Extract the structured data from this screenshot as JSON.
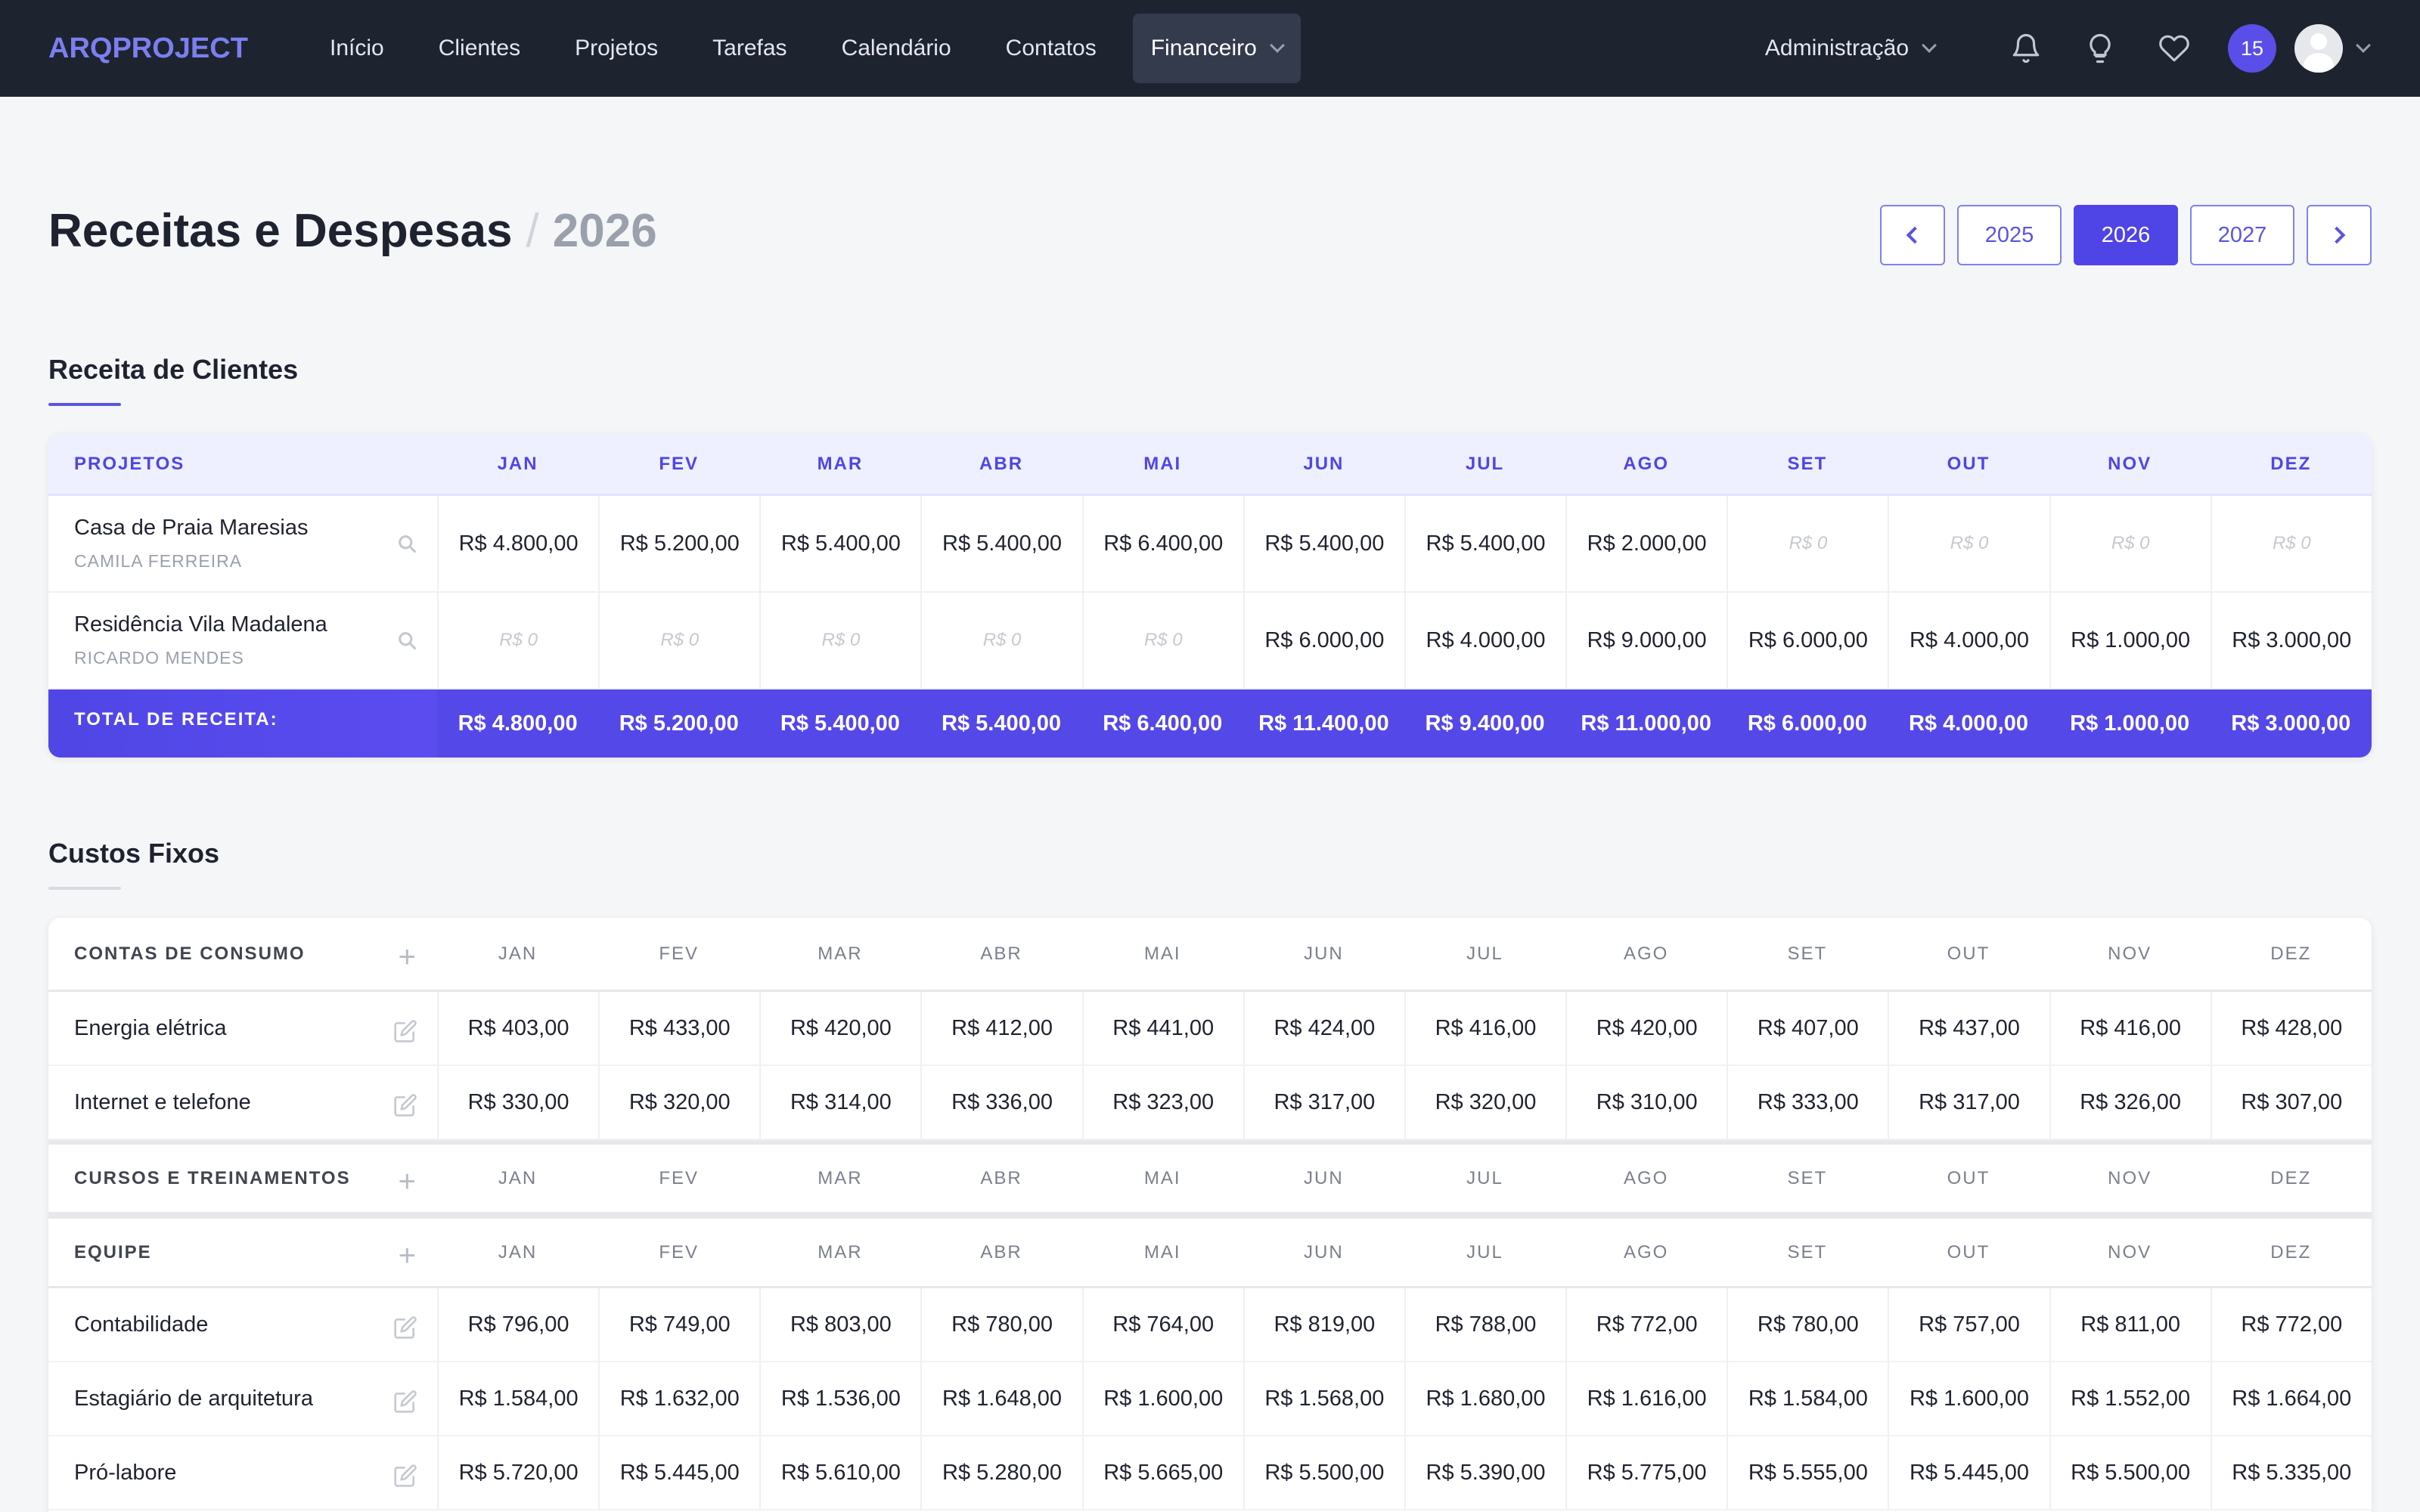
{
  "brand": {
    "logo_text": "ARQPROJECT",
    "accent": "#4f46e5",
    "nav_bg": "#1e2330"
  },
  "nav": {
    "items": [
      {
        "label": "Início"
      },
      {
        "label": "Clientes"
      },
      {
        "label": "Projetos"
      },
      {
        "label": "Tarefas"
      },
      {
        "label": "Calendário"
      },
      {
        "label": "Contatos"
      },
      {
        "label": "Financeiro",
        "active": true
      }
    ],
    "admin_label": "Administração",
    "icons": [
      "bell-icon",
      "lightbulb-icon",
      "heart-icon"
    ],
    "badge_count": "15",
    "avatar": "avatar"
  },
  "page": {
    "title": "Receitas e Despesas",
    "separator": "/",
    "year": "2026",
    "year_options": [
      "2025",
      "2026",
      "2027"
    ],
    "active_year": "2026"
  },
  "months": [
    "JAN",
    "FEV",
    "MAR",
    "ABR",
    "MAI",
    "JUN",
    "JUL",
    "AGO",
    "SET",
    "OUT",
    "NOV",
    "DEZ"
  ],
  "revenue": {
    "section_title": "Receita de Clientes",
    "header_label": "PROJETOS",
    "projects": [
      {
        "name": "Casa de Praia Maresias",
        "client": "CAMILA FERREIRA",
        "values": [
          "R$ 4.800,00",
          "R$ 5.200,00",
          "R$ 5.400,00",
          "R$ 5.400,00",
          "R$ 6.400,00",
          "R$ 5.400,00",
          "R$ 5.400,00",
          "R$ 2.000,00",
          "R$ 0",
          "R$ 0",
          "R$ 0",
          "R$ 0"
        ]
      },
      {
        "name": "Residência Vila Madalena",
        "client": "RICARDO MENDES",
        "values": [
          "R$ 0",
          "R$ 0",
          "R$ 0",
          "R$ 0",
          "R$ 0",
          "R$ 6.000,00",
          "R$ 4.000,00",
          "R$ 9.000,00",
          "R$ 6.000,00",
          "R$ 4.000,00",
          "R$ 1.000,00",
          "R$ 3.000,00"
        ]
      }
    ],
    "total_label": "TOTAL DE RECEITA:",
    "totals": [
      "R$ 4.800,00",
      "R$ 5.200,00",
      "R$ 5.400,00",
      "R$ 5.400,00",
      "R$ 6.400,00",
      "R$ 11.400,00",
      "R$ 9.400,00",
      "R$ 11.000,00",
      "R$ 6.000,00",
      "R$ 4.000,00",
      "R$ 1.000,00",
      "R$ 3.000,00"
    ]
  },
  "costs": {
    "section_title": "Custos Fixos",
    "groups": [
      {
        "label": "CONTAS DE CONSUMO",
        "rows": [
          {
            "name": "Energia elétrica",
            "values": [
              "R$ 403,00",
              "R$ 433,00",
              "R$ 420,00",
              "R$ 412,00",
              "R$ 441,00",
              "R$ 424,00",
              "R$ 416,00",
              "R$ 420,00",
              "R$ 407,00",
              "R$ 437,00",
              "R$ 416,00",
              "R$ 428,00"
            ]
          },
          {
            "name": "Internet e telefone",
            "values": [
              "R$ 330,00",
              "R$ 320,00",
              "R$ 314,00",
              "R$ 336,00",
              "R$ 323,00",
              "R$ 317,00",
              "R$ 320,00",
              "R$ 310,00",
              "R$ 333,00",
              "R$ 317,00",
              "R$ 326,00",
              "R$ 307,00"
            ]
          }
        ]
      },
      {
        "label": "CURSOS E TREINAMENTOS",
        "rows": []
      },
      {
        "label": "EQUIPE",
        "rows": [
          {
            "name": "Contabilidade",
            "values": [
              "R$ 796,00",
              "R$ 749,00",
              "R$ 803,00",
              "R$ 780,00",
              "R$ 764,00",
              "R$ 819,00",
              "R$ 788,00",
              "R$ 772,00",
              "R$ 780,00",
              "R$ 757,00",
              "R$ 811,00",
              "R$ 772,00"
            ]
          },
          {
            "name": "Estagiário de arquitetura",
            "values": [
              "R$ 1.584,00",
              "R$ 1.632,00",
              "R$ 1.536,00",
              "R$ 1.648,00",
              "R$ 1.600,00",
              "R$ 1.568,00",
              "R$ 1.680,00",
              "R$ 1.616,00",
              "R$ 1.584,00",
              "R$ 1.600,00",
              "R$ 1.552,00",
              "R$ 1.664,00"
            ]
          },
          {
            "name": "Pró-labore",
            "values": [
              "R$ 5.720,00",
              "R$ 5.445,00",
              "R$ 5.610,00",
              "R$ 5.280,00",
              "R$ 5.665,00",
              "R$ 5.500,00",
              "R$ 5.390,00",
              "R$ 5.775,00",
              "R$ 5.555,00",
              "R$ 5.445,00",
              "R$ 5.500,00",
              "R$ 5.335,00"
            ]
          }
        ]
      }
    ]
  }
}
